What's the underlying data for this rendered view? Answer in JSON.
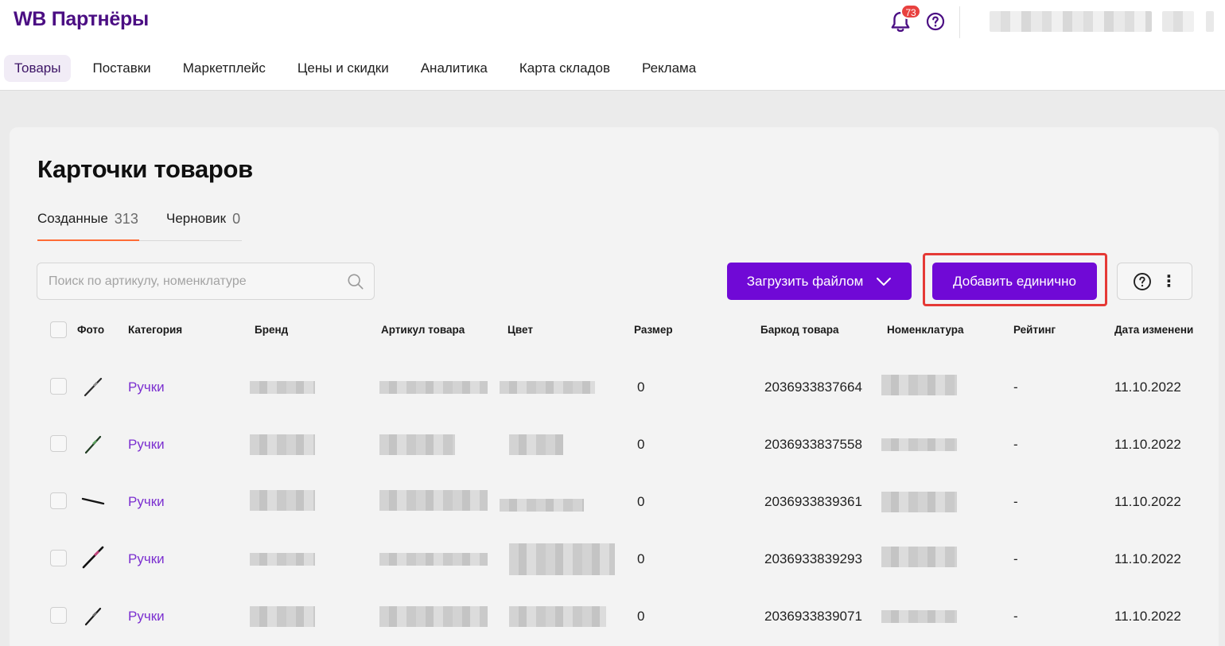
{
  "brand": {
    "logo": "WB Партнёры",
    "accent": "#7009d6"
  },
  "header": {
    "notifications_count": "73",
    "icons": [
      "bell-icon",
      "help-icon"
    ]
  },
  "nav": {
    "items": [
      {
        "label": "Товары",
        "active": true
      },
      {
        "label": "Поставки",
        "active": false
      },
      {
        "label": "Маркетплейс",
        "active": false
      },
      {
        "label": "Цены и скидки",
        "active": false
      },
      {
        "label": "Аналитика",
        "active": false
      },
      {
        "label": "Карта складов",
        "active": false
      },
      {
        "label": "Реклама",
        "active": false
      }
    ]
  },
  "page": {
    "title": "Карточки товаров",
    "tabs": [
      {
        "label": "Созданные",
        "count": "313",
        "active": true
      },
      {
        "label": "Черновик",
        "count": "0",
        "active": false
      }
    ]
  },
  "toolbar": {
    "search_placeholder": "Поиск по артикулу, номенклатуре",
    "upload_label": "Загрузить файлом",
    "add_label": "Добавить единично"
  },
  "table": {
    "columns": [
      "Фото",
      "Категория",
      "Бренд",
      "Артикул товара",
      "Цвет",
      "Размер",
      "Баркод товара",
      "Номенклатура",
      "Рейтинг",
      "Дата изменени"
    ],
    "rows": [
      {
        "category": "Ручки",
        "size": "0",
        "barcode": "2036933837664",
        "rating": "-",
        "date": "11.10.2022"
      },
      {
        "category": "Ручки",
        "size": "0",
        "barcode": "2036933837558",
        "rating": "-",
        "date": "11.10.2022"
      },
      {
        "category": "Ручки",
        "size": "0",
        "barcode": "2036933839361",
        "rating": "-",
        "date": "11.10.2022"
      },
      {
        "category": "Ручки",
        "size": "0",
        "barcode": "2036933839293",
        "rating": "-",
        "date": "11.10.2022"
      },
      {
        "category": "Ручки",
        "size": "0",
        "barcode": "2036933839071",
        "rating": "-",
        "date": "11.10.2022"
      }
    ]
  }
}
